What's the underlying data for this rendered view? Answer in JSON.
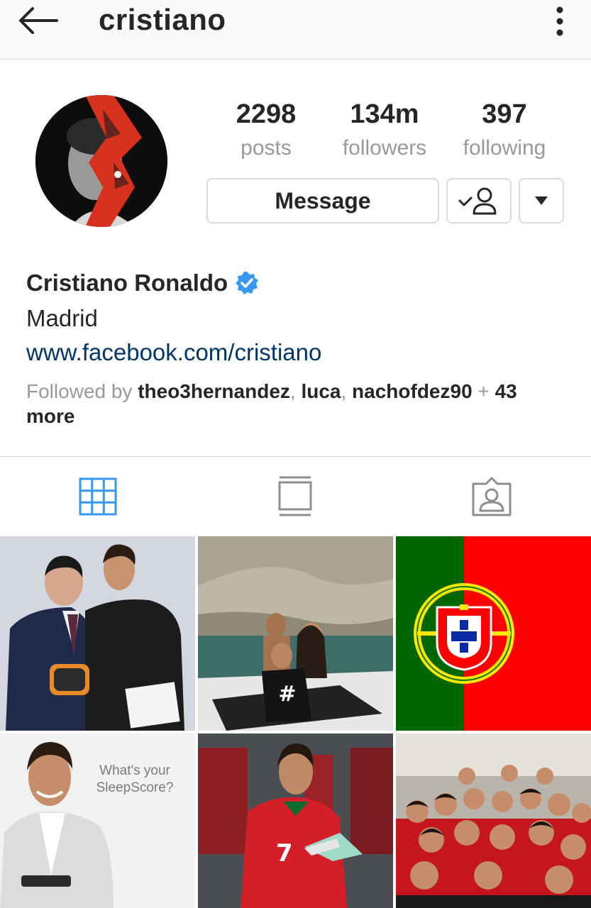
{
  "header": {
    "username": "cristiano"
  },
  "profile": {
    "stats": {
      "posts": {
        "value": "2298",
        "label": "posts"
      },
      "followers": {
        "value": "134m",
        "label": "followers"
      },
      "following": {
        "value": "397",
        "label": "following"
      }
    },
    "message_label": "Message",
    "full_name": "Cristiano Ronaldo",
    "city": "Madrid",
    "website": "www.facebook.com/cristiano",
    "followed_by": {
      "prefix": "Followed by ",
      "names": [
        "theo3hernandez",
        "luca",
        "nachofdez90"
      ],
      "sep": ", ",
      "plus": " + ",
      "more": "43 more"
    }
  },
  "tiles": {
    "t5_line1": "What's your",
    "t5_line2": "SleepScore?"
  },
  "colors": {
    "accent": "#3897f0",
    "link": "#003569",
    "border": "#dbdbdb",
    "muted": "#999999"
  }
}
